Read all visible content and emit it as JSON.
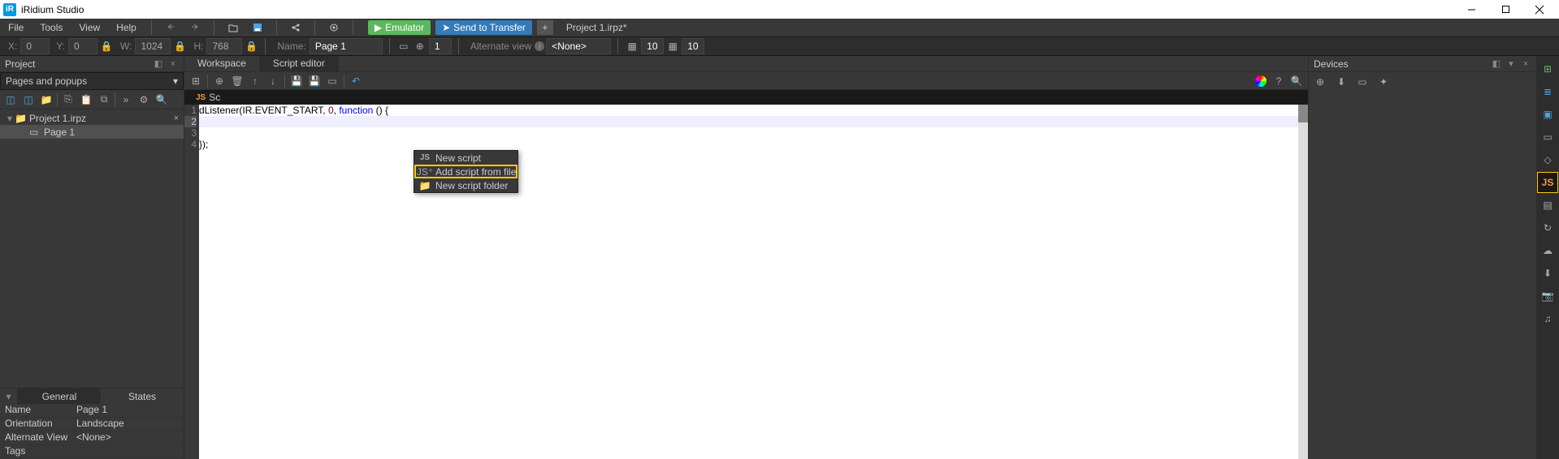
{
  "app_title": "iRidium Studio",
  "menu": {
    "file": "File",
    "tools": "Tools",
    "view": "View",
    "help": "Help"
  },
  "buttons": {
    "emulator": "Emulator",
    "send": "Send to Transfer"
  },
  "open_project_tab": "Project 1.irpz*",
  "props_bar": {
    "x_label": "X:",
    "x_val": "0",
    "y_label": "Y:",
    "y_val": "0",
    "w_label": "W:",
    "w_val": "1024",
    "h_label": "H:",
    "h_val": "768",
    "name_label": "Name:",
    "name_val": "Page 1",
    "step_val": "1",
    "alt_label": "Alternate view",
    "alt_val": "<None>",
    "grid1": "10",
    "grid2": "10"
  },
  "left": {
    "panel_title": "Project",
    "pages_dd": "Pages and popups",
    "tree": {
      "root": "Project 1.irpz",
      "page": "Page 1"
    },
    "tabs": {
      "general": "General",
      "states": "States"
    },
    "props": [
      {
        "k": "Name",
        "v": "Page 1"
      },
      {
        "k": "Orientation",
        "v": "Landscape"
      },
      {
        "k": "Alternate View",
        "v": "<None>"
      },
      {
        "k": "Tags",
        "v": ""
      }
    ]
  },
  "center": {
    "tabs": {
      "workspace": "Workspace",
      "script_editor": "Script editor"
    },
    "script_tab": "Sc",
    "code_line1_a": "dListener(IR.EVENT_START, ",
    "code_line1_num": "0",
    "code_line1_b": ", ",
    "code_line1_kw": "function",
    "code_line1_c": " () {",
    "code_line3": "});",
    "context_menu": {
      "new_script": "New script",
      "add_from_file": "Add script from file",
      "new_folder": "New script folder"
    }
  },
  "right": {
    "panel_title": "Devices"
  },
  "side_js": "JS"
}
